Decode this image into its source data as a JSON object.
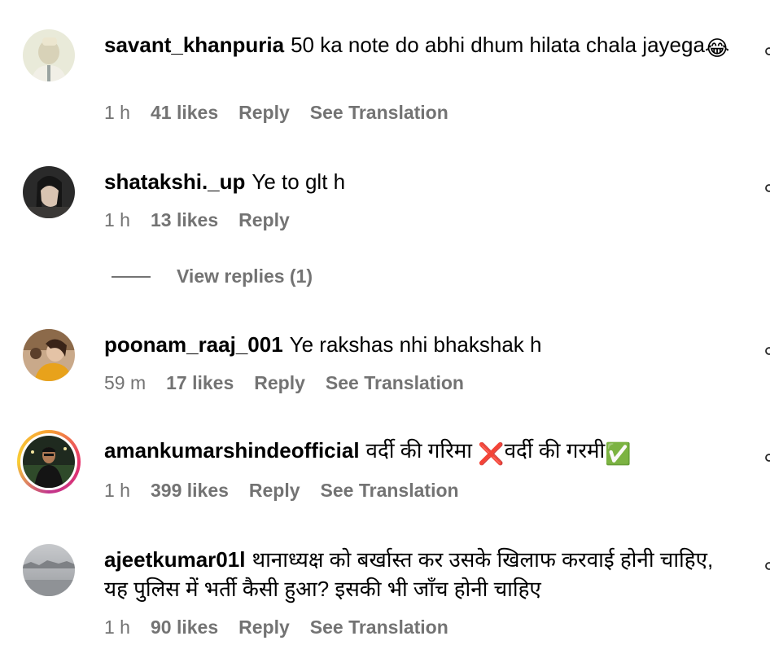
{
  "comments": [
    {
      "username": "savant_khanpuria",
      "text": "50 ka note do abhi dhum hilata chala jayega",
      "emoji": "😂",
      "time": "1 h",
      "likes": "41 likes",
      "reply": "Reply",
      "translation": "See Translation"
    },
    {
      "username": "shatakshi._up",
      "text": "Ye to glt h",
      "time": "1 h",
      "likes": "13 likes",
      "reply": "Reply",
      "view_replies": "View replies (1)"
    },
    {
      "username": "poonam_raaj_001",
      "text": "Ye rakshas nhi bhakshak h",
      "time": "59 m",
      "likes": "17 likes",
      "reply": "Reply",
      "translation": "See Translation"
    },
    {
      "username": "amankumarshindeofficial",
      "text_part1": "वर्दी की गरिमा ",
      "emoji1": "❌",
      "text_part2": "वर्दी की गरमी",
      "emoji2": "✅",
      "time": "1 h",
      "likes": "399 likes",
      "reply": "Reply",
      "translation": "See Translation"
    },
    {
      "username": "ajeetkumar01l",
      "text": "थानाध्यक्ष को बर्खास्त कर उसके खिलाफ करवाई होनी चाहिए, यह पुलिस में भर्ती कैसी हुआ? इसकी भी जाँच होनी चाहिए",
      "time": "1 h",
      "likes": "90 likes",
      "reply": "Reply",
      "translation": "See Translation"
    }
  ],
  "colors": {
    "secondary_text": "#737373",
    "story_ring": "#e6336b"
  }
}
